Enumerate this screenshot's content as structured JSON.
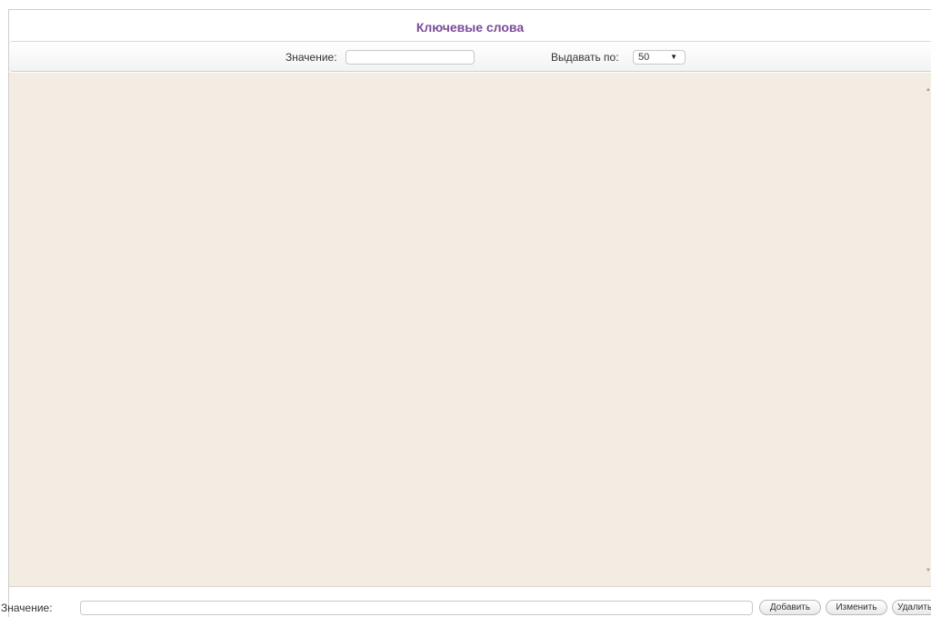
{
  "header": {
    "title": "Ключевые слова"
  },
  "filter": {
    "value_label": "Значение:",
    "value_input": "",
    "page_size_label": "Выдавать по:",
    "page_size_value": "50"
  },
  "footer": {
    "value_label": "Значение:",
    "value_input": "",
    "add_label": "Добавить",
    "edit_label": "Изменить",
    "delete_label": "Удалить"
  },
  "colors": {
    "title": "#7a4a9a",
    "content_background": "#f3ece3"
  }
}
